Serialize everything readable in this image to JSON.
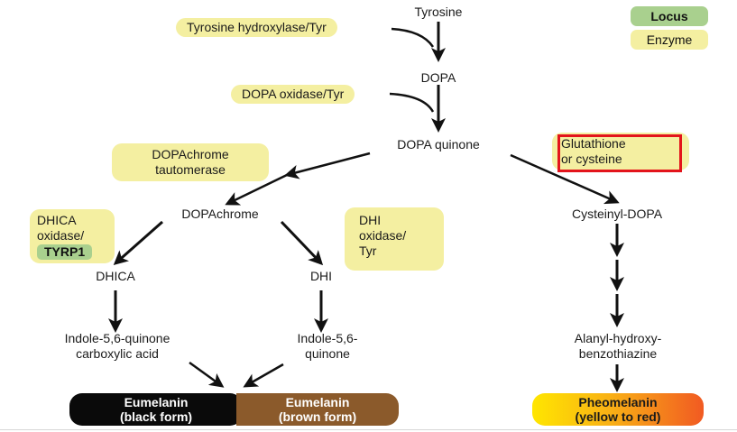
{
  "legend": {
    "locus": "Locus",
    "enzyme": "Enzyme"
  },
  "nodes": {
    "tyrosine": "Tyrosine",
    "dopa": "DOPA",
    "dopa_quinone": "DOPA quinone",
    "dopachrome": "DOPAchrome",
    "cysteinyl_dopa": "Cysteinyl-DOPA",
    "dhica": "DHICA",
    "dhi": "DHI",
    "indole_carboxylic_line1": "Indole-5,6-quinone",
    "indole_carboxylic_line2": "carboxylic acid",
    "indole_quinone_line1": "Indole-5,6-",
    "indole_quinone_line2": "quinone",
    "alanyl_line1": "Alanyl-hydroxy-",
    "alanyl_line2": "benzothiazine"
  },
  "enzymes": {
    "tyrosine_hydroxylase": "Tyrosine hydroxylase/Tyr",
    "dopa_oxidase": "DOPA oxidase/Tyr",
    "dopachrome_taut_line1": "DOPAchrome",
    "dopachrome_taut_line2": "tautomerase",
    "glutathione_line1": "Glutathione",
    "glutathione_line2": "or cysteine",
    "dhica_oxidase_line1": "DHICA",
    "dhica_oxidase_line2": "oxidase/",
    "tyrp1": "TYRP1",
    "dhi_oxidase_line1": "DHI",
    "dhi_oxidase_line2": "oxidase/",
    "dhi_oxidase_line3": "Tyr"
  },
  "pigments": {
    "eumelanin_black_line1": "Eumelanin",
    "eumelanin_black_line2": "(black form)",
    "eumelanin_brown_line1": "Eumelanin",
    "eumelanin_brown_line2": "(brown form)",
    "pheomelanin_line1": "Pheomelanin",
    "pheomelanin_line2": "(yellow to red)"
  },
  "colors": {
    "enzyme": "#f4efa1",
    "locus": "#a9d08e",
    "highlight": "#e3141b",
    "eumelanin_black": "#0a0a0a",
    "eumelanin_brown": "#8b5a2b",
    "pheomelanin_start": "#ffe600",
    "pheomelanin_end": "#f15a22"
  }
}
